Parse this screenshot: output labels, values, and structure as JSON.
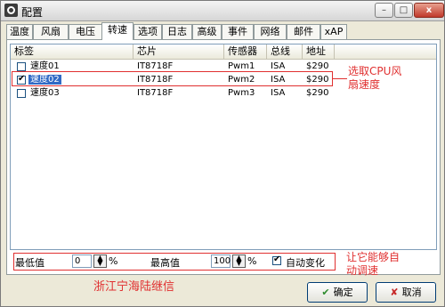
{
  "window": {
    "title": "配置"
  },
  "titlebar": {
    "min": "–",
    "max": "□",
    "close": "x"
  },
  "tabs": [
    "温度",
    "风扇",
    "电压",
    "转速",
    "选项",
    "日志",
    "高级",
    "事件",
    "网络",
    "邮件",
    "xAP"
  ],
  "active_tab": "转速",
  "table": {
    "headers": [
      "标签",
      "芯片",
      "传感器",
      "总线",
      "地址"
    ],
    "rows": [
      {
        "checked": false,
        "label": "速度01",
        "chip": "IT8718F",
        "sensor": "Pwm1",
        "bus": "ISA",
        "addr": "$290"
      },
      {
        "checked": true,
        "label": "速度02",
        "chip": "IT8718F",
        "sensor": "Pwm2",
        "bus": "ISA",
        "addr": "$290"
      },
      {
        "checked": false,
        "label": "速度03",
        "chip": "IT8718F",
        "sensor": "Pwm3",
        "bus": "ISA",
        "addr": "$290"
      }
    ]
  },
  "bottom": {
    "min_label": "最低值",
    "min_value": "0",
    "min_unit": "%",
    "max_label": "最高值",
    "max_value": "100",
    "max_unit": "%",
    "auto_label": "自动变化",
    "auto_checked": true
  },
  "annotations": {
    "select_note_1": "选取CPU风",
    "select_note_2": "扇速度",
    "auto_note_1": "让它能够自",
    "auto_note_2": "动调速",
    "watermark": "浙江宁海陆继信"
  },
  "buttons": {
    "ok": "确定",
    "ok_icon": "✔",
    "cancel": "取消",
    "cancel_icon": "✘"
  },
  "colors": {
    "annotation": "#e03030",
    "selection": "#316ac5"
  }
}
